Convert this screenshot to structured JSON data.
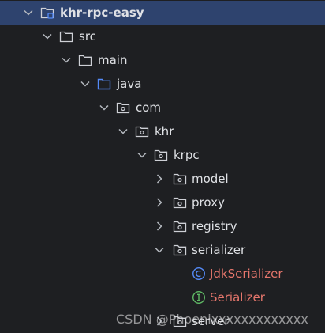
{
  "tree": [
    {
      "label": "khr-rpc-easy",
      "icon": "module-folder-icon",
      "expanded": true
    },
    {
      "label": "src",
      "icon": "folder-icon",
      "expanded": true
    },
    {
      "label": "main",
      "icon": "folder-icon",
      "expanded": true
    },
    {
      "label": "java",
      "icon": "source-root-folder-icon",
      "expanded": true
    },
    {
      "label": "com",
      "icon": "package-icon",
      "expanded": true
    },
    {
      "label": "khr",
      "icon": "package-icon",
      "expanded": true
    },
    {
      "label": "krpc",
      "icon": "package-icon",
      "expanded": true
    },
    {
      "label": "model",
      "icon": "package-icon",
      "expanded": false
    },
    {
      "label": "proxy",
      "icon": "package-icon",
      "expanded": false
    },
    {
      "label": "registry",
      "icon": "package-icon",
      "expanded": false
    },
    {
      "label": "serializer",
      "icon": "package-icon",
      "expanded": true
    },
    {
      "label": "JdkSerializer",
      "icon": "class-icon"
    },
    {
      "label": "Serializer",
      "icon": "interface-icon"
    },
    {
      "label": "server",
      "icon": "package-icon",
      "expanded": false
    }
  ],
  "watermark": "CSDN @Phoenixxxxxxxxxxxxx",
  "colors": {
    "background": "#1e1f22",
    "selection": "#2e436e",
    "text": "#dfe1e5",
    "modified_file_text": "#e5766c",
    "class_icon": "#548af7",
    "interface_icon": "#5fb865",
    "source_root_icon": "#548af7"
  }
}
